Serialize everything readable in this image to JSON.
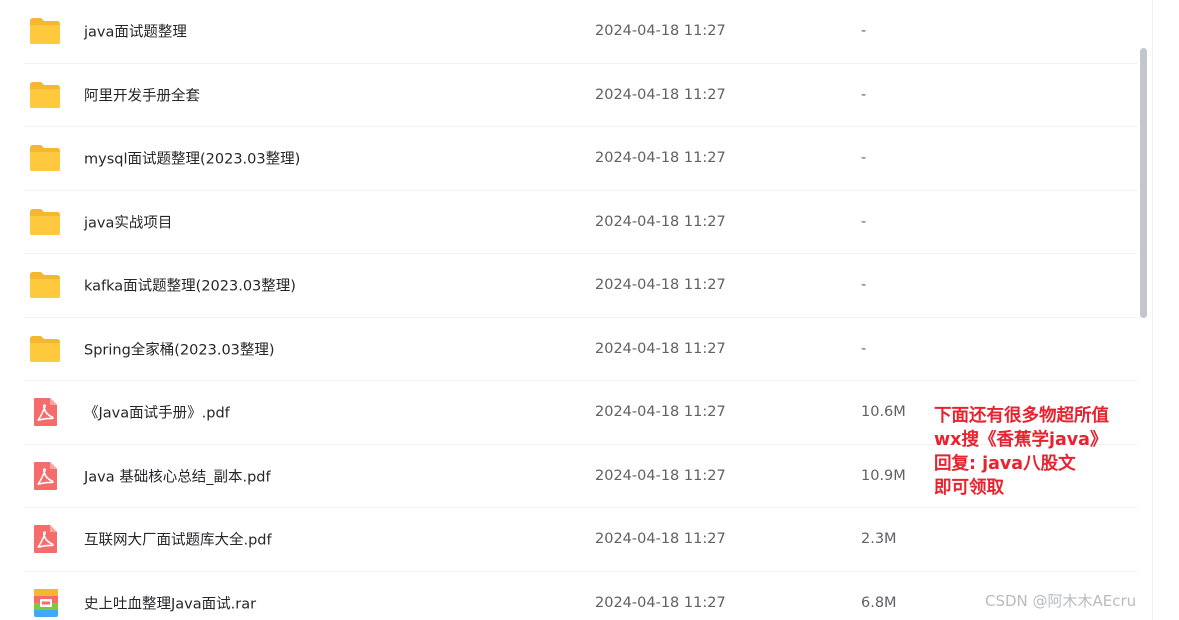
{
  "colors": {
    "folder": "#FFC93D",
    "pdf": "#F56C6C",
    "promo_text": "#E8232F",
    "watermark": "#B9BBBF"
  },
  "files": [
    {
      "name": "java面试题整理",
      "date": "2024-04-18 11:27",
      "size": "-",
      "icon": "folder-icon"
    },
    {
      "name": "阿里开发手册全套",
      "date": "2024-04-18 11:27",
      "size": "-",
      "icon": "folder-icon"
    },
    {
      "name": "mysql面试题整理(2023.03整理)",
      "date": "2024-04-18 11:27",
      "size": "-",
      "icon": "folder-icon"
    },
    {
      "name": "java实战项目",
      "date": "2024-04-18 11:27",
      "size": "-",
      "icon": "folder-icon"
    },
    {
      "name": "kafka面试题整理(2023.03整理)",
      "date": "2024-04-18 11:27",
      "size": "-",
      "icon": "folder-icon"
    },
    {
      "name": "Spring全家桶(2023.03整理)",
      "date": "2024-04-18 11:27",
      "size": "-",
      "icon": "folder-icon"
    },
    {
      "name": "《Java面试手册》.pdf",
      "date": "2024-04-18 11:27",
      "size": "10.6M",
      "icon": "pdf-icon"
    },
    {
      "name": "Java 基础核心总结_副本.pdf",
      "date": "2024-04-18 11:27",
      "size": "10.9M",
      "icon": "pdf-icon"
    },
    {
      "name": "互联网大厂面试题库大全.pdf",
      "date": "2024-04-18 11:27",
      "size": "2.3M",
      "icon": "pdf-icon"
    },
    {
      "name": "史上吐血整理Java面试.rar",
      "date": "2024-04-18 11:27",
      "size": "6.8M",
      "icon": "rar-icon"
    }
  ],
  "promo": {
    "line1": "下面还有很多物超所值",
    "line2": "wx搜《香蕉学java》",
    "line3": "回复: java八股文",
    "line4": "即可领取"
  },
  "watermark": "CSDN @阿木木AEcru"
}
